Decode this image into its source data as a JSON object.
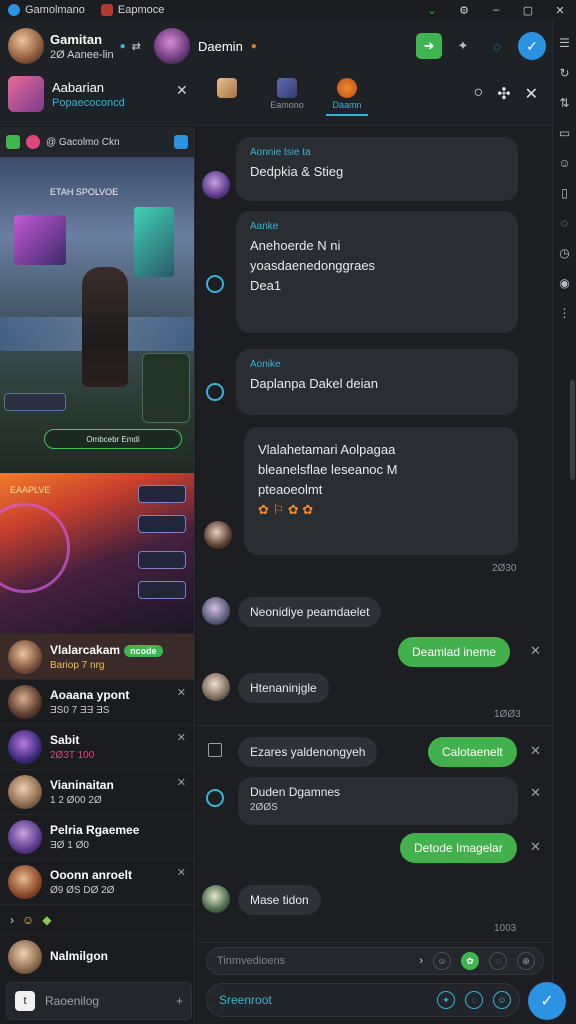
{
  "titlebar": {
    "tabs": [
      {
        "label": "Gamolmano"
      },
      {
        "label": "Eapmoce"
      }
    ],
    "controls": [
      "⌄",
      "⚙",
      "–",
      "▢",
      "✕"
    ]
  },
  "header": {
    "user1": {
      "name": "Gamitan",
      "sub": "2Ø Aanee-lin"
    },
    "user2": {
      "name": "Daemin"
    },
    "channel": {
      "name": "Aabarian",
      "sub": "Popaecoconcd"
    },
    "tabs": [
      {
        "label": ""
      },
      {
        "label": "Eamono"
      },
      {
        "label": "Daamn"
      }
    ],
    "actions": [
      "➜",
      "✦",
      "◌",
      "✓"
    ],
    "tools": [
      "○",
      "✣",
      "✕"
    ]
  },
  "left": {
    "stream_bar": "@ Gacolmo Ckn",
    "stream1": {
      "title": "ETAH SPOLVOE",
      "hud": "Ombcebr  Emdi"
    },
    "stream2": {
      "title": "EAAPLVE"
    },
    "friends": [
      {
        "name": "Vlalarcakam",
        "badge": "ncode",
        "status": "Bariop 7 nrg"
      },
      {
        "name": "Aoaana ypont",
        "status": "ƎS0  7 ƎƎ  ƎS"
      },
      {
        "name": "Sabit",
        "status": "2Ø3T  100"
      },
      {
        "name": "Vianinaitan",
        "status": "1  2  Ø00  2Ø"
      },
      {
        "name": "Pelria Rgaemee",
        "status": "ƎØ  1  Ø0"
      },
      {
        "name": "Ooonn anroelt",
        "status": "Ø9  ØS  DØ 2Ø"
      },
      {
        "name": "Nalmilgon",
        "status": ""
      }
    ],
    "more_label": "›",
    "search_placeholder": "Raoenilog"
  },
  "chat": {
    "messages": [
      {
        "author": "Aonnie tsie ta",
        "lines": [
          "Dedpkia & Stieg"
        ]
      },
      {
        "author": "Aanke",
        "lines": [
          "Anehoerde N ni",
          "yoasdaenedonggraes",
          "Dea1"
        ]
      },
      {
        "author": "Aonike",
        "lines": [
          "Daplanpa Dakel deian"
        ]
      },
      {
        "author": "",
        "lines": [
          "Vlalahetamari Aolpagaa",
          "bleanelsflae leseanoc M",
          "pteaoeolmt"
        ],
        "time": "2Ø30"
      },
      {
        "text": "Neonidiye peamdaelet"
      },
      {
        "text": "Deamlad ineme"
      },
      {
        "text": "Htenaninjgle",
        "time": "1ØØ3"
      },
      {
        "text": "Ezares yaldenongyeh"
      },
      {
        "text": "Calotaenelt"
      },
      {
        "author": "Duden Dgamnes",
        "text": "2ØØS"
      },
      {
        "text": "Detode Imagelar"
      },
      {
        "text": "Mase tidon",
        "time": "1003"
      }
    ]
  },
  "composer": {
    "top_placeholder": "Tinmvedioens",
    "bottom_placeholder": "Sreenroot"
  },
  "colors": {
    "accent": "#35b6d6",
    "green": "#42b04c",
    "send": "#2b93e2"
  }
}
